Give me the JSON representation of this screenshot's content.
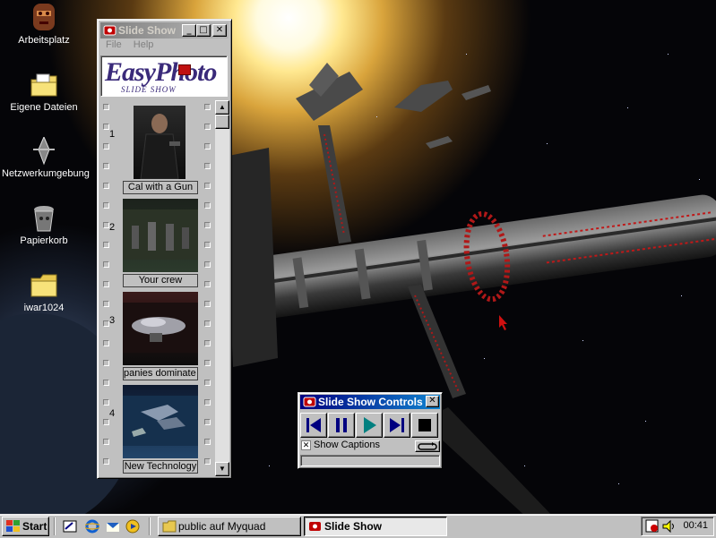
{
  "desktop": {
    "icons": [
      {
        "label": "Arbeitsplatz"
      },
      {
        "label": "Eigene Dateien"
      },
      {
        "label": "Netzwerkumgebung"
      },
      {
        "label": "Papierkorb"
      },
      {
        "label": "iwar1024"
      }
    ]
  },
  "slideshow_window": {
    "title": "Slide Show",
    "menu": [
      "File",
      "Help"
    ],
    "logo": {
      "easy": "Easy",
      "photo": "Photo",
      "sub": "SLIDE SHOW"
    },
    "frames": [
      {
        "number": "1",
        "caption": "Cal with a Gun"
      },
      {
        "number": "2",
        "caption": "Your crew"
      },
      {
        "number": "3",
        "caption": "panies dominate s"
      },
      {
        "number": "4",
        "caption": "New Technology"
      }
    ]
  },
  "controls_window": {
    "title": "Slide Show Controls",
    "show_captions_label": "Show Captions",
    "show_captions_checked": true,
    "close_glyph": "✕"
  },
  "taskbar": {
    "start_label": "Start",
    "tasks": [
      {
        "label": "public auf Myquad"
      },
      {
        "label": "Slide Show"
      }
    ],
    "clock": "00:41"
  },
  "colors": {
    "win_gray": "#c0c0c0",
    "title_active": "#000080",
    "play_green": "#008080",
    "nav_blue": "#000080"
  }
}
